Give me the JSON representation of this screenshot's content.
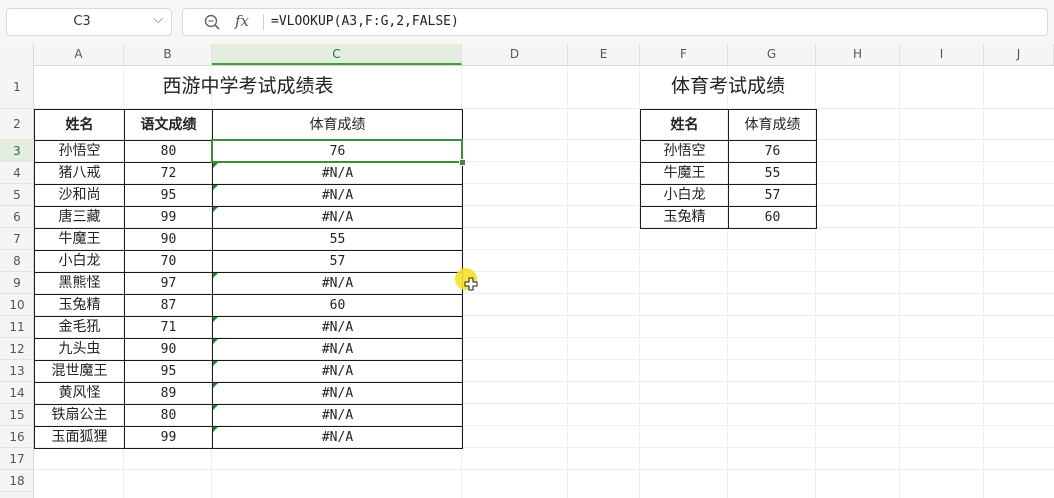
{
  "name_box": {
    "value": "C3"
  },
  "formula": {
    "text": "=VLOOKUP(A3,F:G,2,FALSE)",
    "fx_label": "fx"
  },
  "columns": [
    "A",
    "B",
    "C",
    "D",
    "E",
    "F",
    "G",
    "H",
    "I",
    "J"
  ],
  "rows": [
    "1",
    "2",
    "3",
    "4",
    "5",
    "6",
    "7",
    "8",
    "9",
    "10",
    "11",
    "12",
    "13",
    "14",
    "15",
    "16",
    "17",
    "18"
  ],
  "left_table": {
    "title": "西游中学考试成绩表",
    "headers": [
      "姓名",
      "语文成绩",
      "体育成绩"
    ],
    "rows": [
      [
        "孙悟空",
        "80",
        "76"
      ],
      [
        "猪八戒",
        "72",
        "#N/A"
      ],
      [
        "沙和尚",
        "95",
        "#N/A"
      ],
      [
        "唐三藏",
        "99",
        "#N/A"
      ],
      [
        "牛魔王",
        "90",
        "55"
      ],
      [
        "小白龙",
        "70",
        "57"
      ],
      [
        "黑熊怪",
        "97",
        "#N/A"
      ],
      [
        "玉兔精",
        "87",
        "60"
      ],
      [
        "金毛犼",
        "71",
        "#N/A"
      ],
      [
        "九头虫",
        "90",
        "#N/A"
      ],
      [
        "混世魔王",
        "95",
        "#N/A"
      ],
      [
        "黄风怪",
        "89",
        "#N/A"
      ],
      [
        "铁扇公主",
        "80",
        "#N/A"
      ],
      [
        "玉面狐狸",
        "99",
        "#N/A"
      ]
    ]
  },
  "right_table": {
    "title": "体育考试成绩",
    "headers": [
      "姓名",
      "体育成绩"
    ],
    "rows": [
      [
        "孙悟空",
        "76"
      ],
      [
        "牛魔王",
        "55"
      ],
      [
        "小白龙",
        "57"
      ],
      [
        "玉兔精",
        "60"
      ]
    ]
  },
  "colors": {
    "accent": "#3d8f35",
    "selected_header_bg": "#e3eedf",
    "border": "#1a1a1a"
  }
}
